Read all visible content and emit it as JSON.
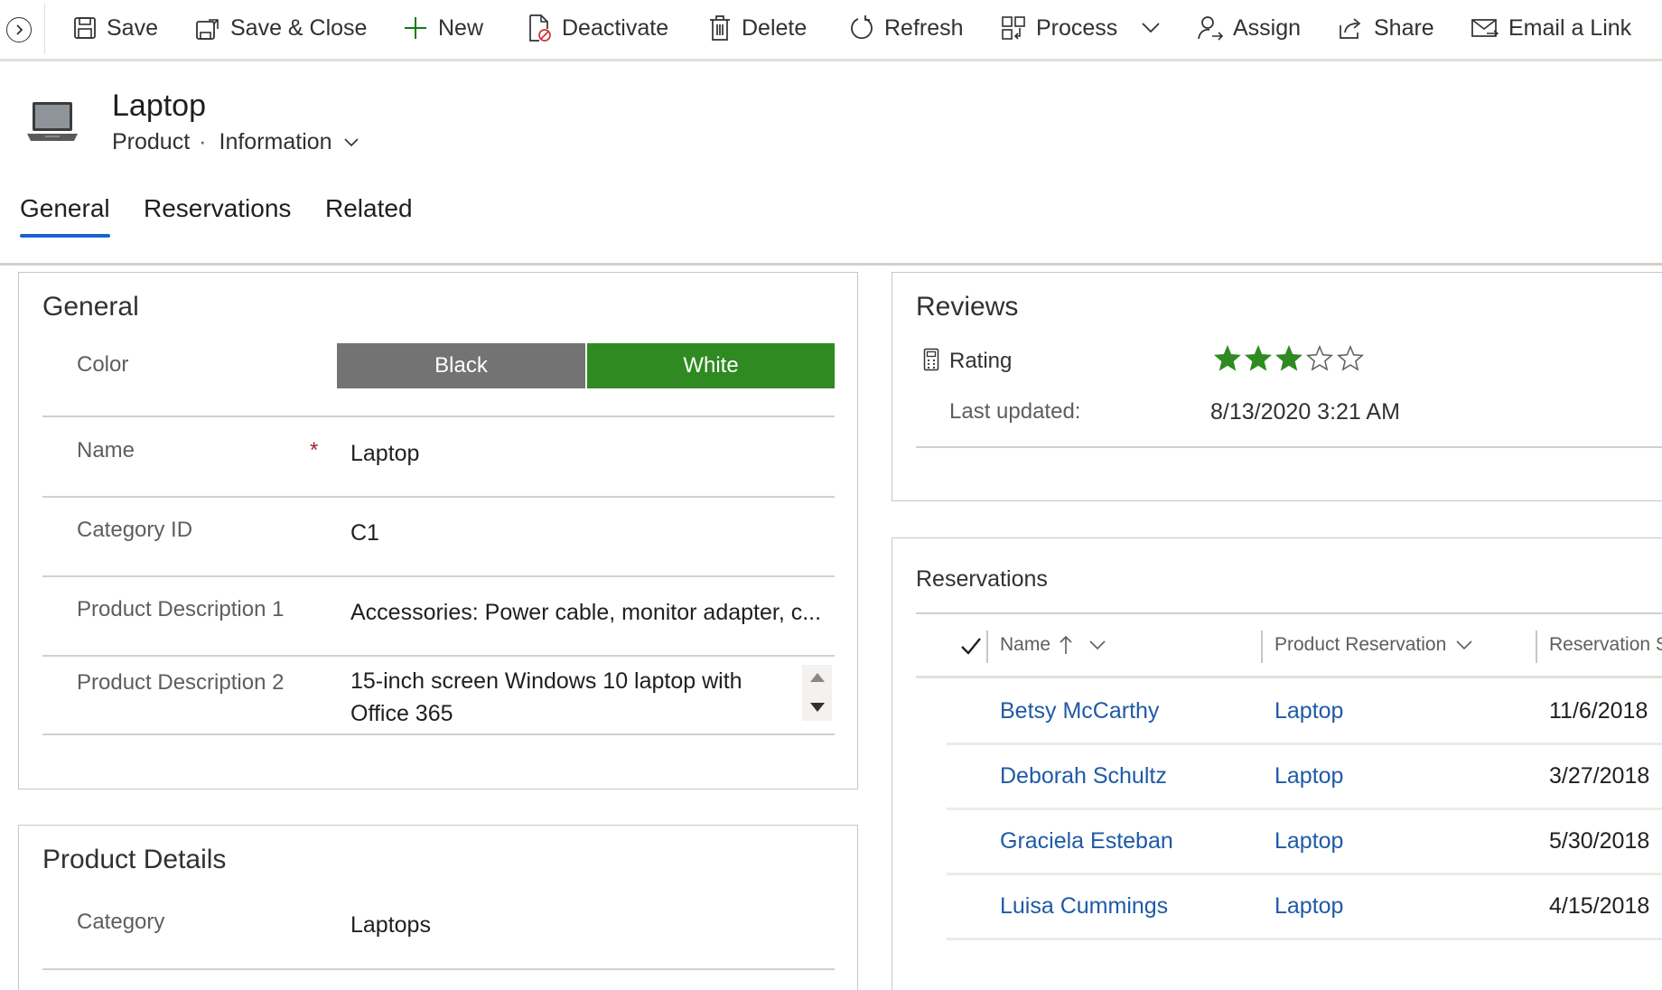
{
  "command_bar": {
    "buttons": [
      {
        "label": "Save",
        "icon": "save-icon"
      },
      {
        "label": "Save & Close",
        "icon": "save-close-icon"
      },
      {
        "label": "New",
        "icon": "plus-icon"
      },
      {
        "label": "Deactivate",
        "icon": "deactivate-icon"
      },
      {
        "label": "Delete",
        "icon": "trash-icon"
      },
      {
        "label": "Refresh",
        "icon": "refresh-icon"
      },
      {
        "label": "Process",
        "icon": "process-icon"
      },
      {
        "label": "Assign",
        "icon": "assign-icon"
      },
      {
        "label": "Share",
        "icon": "share-icon"
      },
      {
        "label": "Email a Link",
        "icon": "email-icon"
      }
    ]
  },
  "header": {
    "title": "Laptop",
    "entity": "Product",
    "separator": "·",
    "form": "Information"
  },
  "tabs": [
    {
      "label": "General",
      "selected": true
    },
    {
      "label": "Reservations",
      "selected": false
    },
    {
      "label": "Related",
      "selected": false
    }
  ],
  "general": {
    "title": "General",
    "color": {
      "label": "Color",
      "options": [
        {
          "label": "Black",
          "color": "#737373",
          "selected": false
        },
        {
          "label": "White",
          "color": "#2f8a21",
          "selected": true
        }
      ]
    },
    "name": {
      "label": "Name",
      "required_marker": "*",
      "value": "Laptop"
    },
    "category_id": {
      "label": "Category ID",
      "value": "C1"
    },
    "desc1": {
      "label": "Product Description 1",
      "value": "Accessories: Power cable, monitor adapter, c..."
    },
    "desc2": {
      "label": "Product Description 2",
      "value": "15-inch screen Windows 10 laptop with Office 365"
    }
  },
  "product_details": {
    "title": "Product Details",
    "category": {
      "label": "Category",
      "value": "Laptops"
    }
  },
  "reviews": {
    "title": "Reviews",
    "rating": {
      "label": "Rating",
      "value": 3,
      "max": 5,
      "star_color": "#2f8a21"
    },
    "last_updated": {
      "label": "Last updated:",
      "value": "8/13/2020 3:21 AM"
    }
  },
  "reservations": {
    "title": "Reservations",
    "columns": [
      "Name",
      "Product Reservation",
      "Reservation S"
    ],
    "rows": [
      {
        "name": "Betsy McCarthy",
        "product": "Laptop",
        "date": "11/6/2018"
      },
      {
        "name": "Deborah Schultz",
        "product": "Laptop",
        "date": "3/27/2018"
      },
      {
        "name": "Graciela Esteban",
        "product": "Laptop",
        "date": "5/30/2018"
      },
      {
        "name": "Luisa Cummings",
        "product": "Laptop",
        "date": "4/15/2018"
      }
    ]
  },
  "colors": {
    "accent": "#1a62d2",
    "link": "#1f5aa6",
    "required": "#a4262c"
  }
}
